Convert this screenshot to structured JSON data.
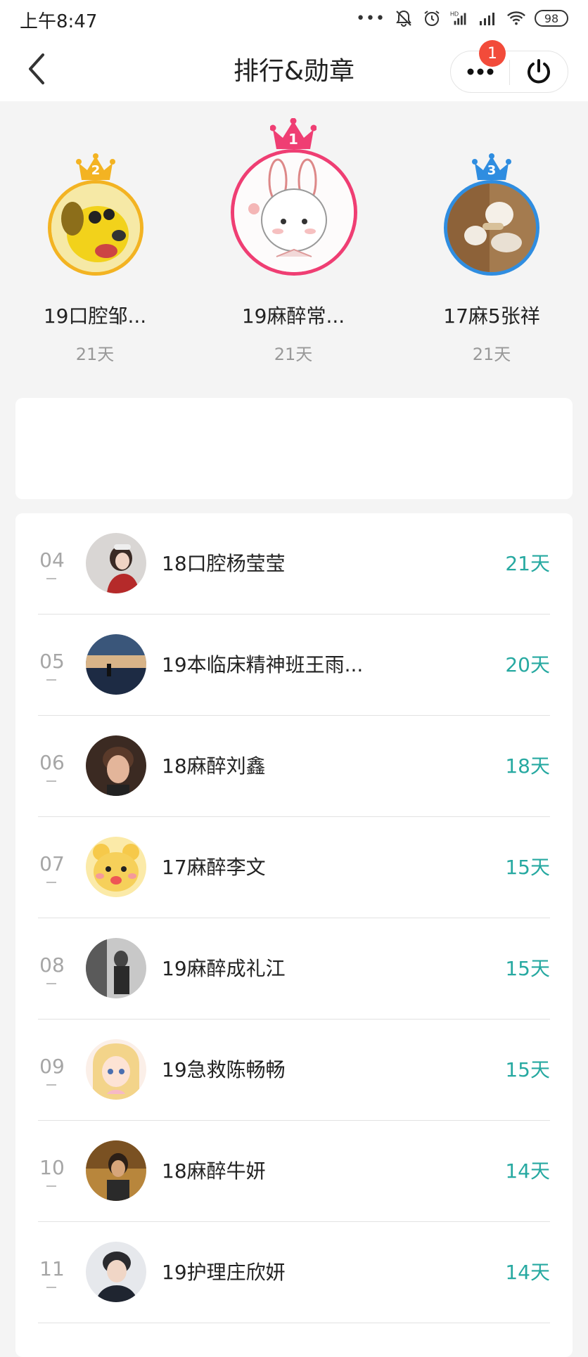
{
  "status_bar": {
    "time": "上午8:47",
    "battery": "98",
    "icons": [
      "more-dots-icon",
      "bell-mute-icon",
      "alarm-icon",
      "hd-signal-icon",
      "signal-icon",
      "wifi-icon",
      "battery-icon"
    ]
  },
  "header": {
    "title": "排行&勋章",
    "badge_count": "1",
    "icons": [
      "back-icon",
      "more-icon",
      "power-icon"
    ]
  },
  "podium": [
    {
      "rank": "2",
      "name": "19口腔邹...",
      "days": "21天",
      "crown_color": "#f3b322",
      "border_color": "#f3b322"
    },
    {
      "rank": "1",
      "name": "19麻醉常...",
      "days": "21天",
      "crown_color": "#ef3e73",
      "border_color": "#ef3e73"
    },
    {
      "rank": "3",
      "name": "17麻5张祥",
      "days": "21天",
      "crown_color": "#2f8de0",
      "border_color": "#2f8de0"
    }
  ],
  "list": [
    {
      "rank": "04",
      "name": "18口腔杨莹莹",
      "days": "21天"
    },
    {
      "rank": "05",
      "name": "19本临床精神班王雨...",
      "days": "20天"
    },
    {
      "rank": "06",
      "name": "18麻醉刘鑫",
      "days": "18天"
    },
    {
      "rank": "07",
      "name": "17麻醉李文",
      "days": "15天"
    },
    {
      "rank": "08",
      "name": "19麻醉成礼江",
      "days": "15天"
    },
    {
      "rank": "09",
      "name": "19急救陈畅畅",
      "days": "15天"
    },
    {
      "rank": "10",
      "name": "18麻醉牛妍",
      "days": "14天"
    },
    {
      "rank": "11",
      "name": "19护理庄欣妍",
      "days": "14天"
    }
  ],
  "colors": {
    "accent_days": "#27a9a1",
    "badge": "#f24b3a",
    "background": "#f4f4f4"
  }
}
